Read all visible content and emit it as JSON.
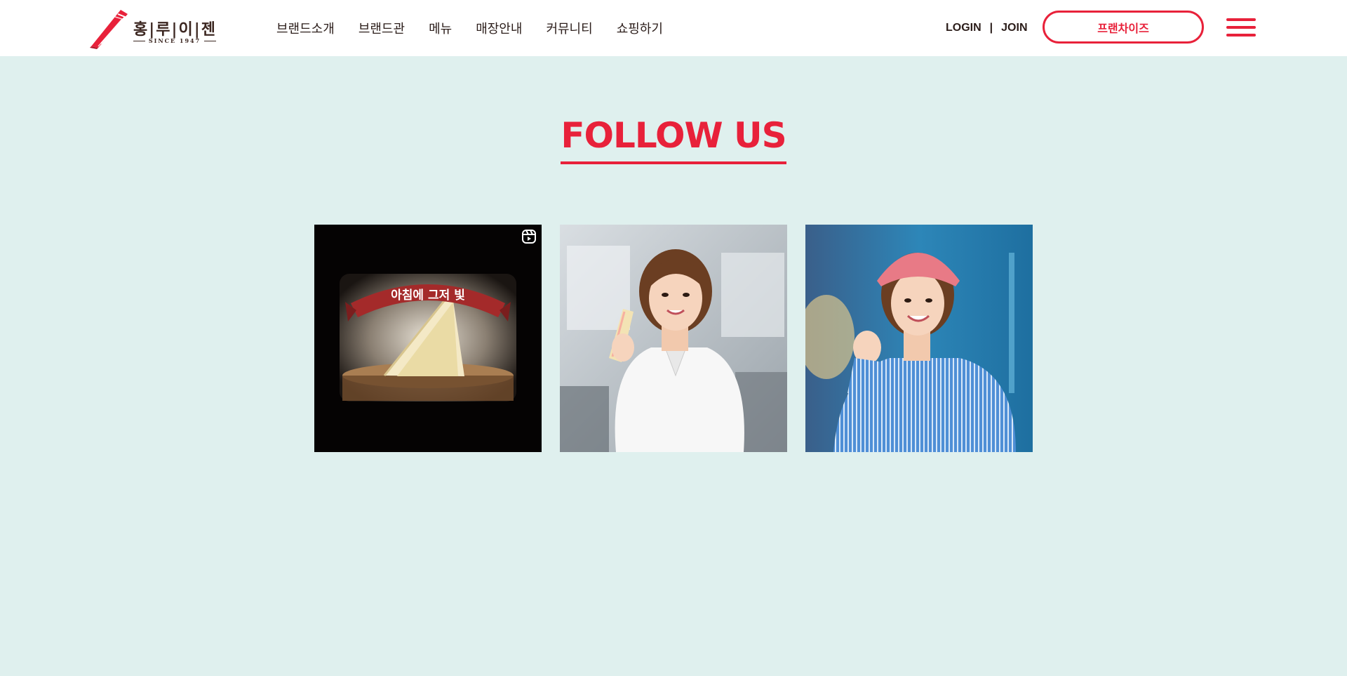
{
  "brand": {
    "name": "홍|루|이|젠",
    "since": "SINCE 1947",
    "accent_color": "#e8213a",
    "background_color": "#dff0ee"
  },
  "nav": {
    "items": [
      {
        "label": "브랜드소개"
      },
      {
        "label": "브랜드관"
      },
      {
        "label": "메뉴"
      },
      {
        "label": "매장안내"
      },
      {
        "label": "커뮤니티"
      },
      {
        "label": "쇼핑하기"
      }
    ]
  },
  "auth": {
    "login": "LOGIN",
    "separator": "|",
    "join": "JOIN"
  },
  "franchise_button": "프랜차이즈",
  "menu_icon": "hamburger-menu-icon",
  "follow": {
    "title": "FOLLOW US",
    "posts": [
      {
        "type": "reel",
        "icon": "instagram-reels-icon",
        "overlay_text": "아침에 그저 빛"
      },
      {
        "type": "image"
      },
      {
        "type": "image"
      }
    ]
  }
}
